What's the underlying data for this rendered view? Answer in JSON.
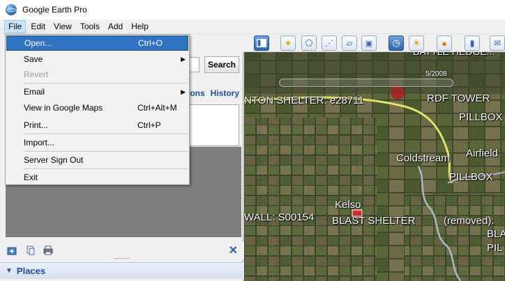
{
  "window": {
    "title": "Google Earth Pro"
  },
  "menubar": {
    "items": [
      "File",
      "Edit",
      "View",
      "Tools",
      "Add",
      "Help"
    ]
  },
  "file_menu": {
    "items": [
      {
        "label": "Open...",
        "shortcut": "Ctrl+O",
        "state": "highlighted"
      },
      {
        "label": "Save",
        "shortcut": "",
        "submenu": true
      },
      {
        "label": "Revert",
        "shortcut": "",
        "state": "disabled"
      },
      {
        "label": "Email",
        "shortcut": "",
        "submenu": true
      },
      {
        "label": "View in Google Maps",
        "shortcut": "Ctrl+Alt+M"
      },
      {
        "label": "Print...",
        "shortcut": "Ctrl+P"
      },
      {
        "label": "Import...",
        "shortcut": ""
      },
      {
        "label": "Server Sign Out",
        "shortcut": ""
      },
      {
        "label": "Exit",
        "shortcut": ""
      }
    ]
  },
  "search": {
    "button_label": "Search",
    "value": ""
  },
  "search_tabs": {
    "directions_partial": "ons",
    "history": "History"
  },
  "places": {
    "header": "Places"
  },
  "map": {
    "time_label": "5/2008",
    "labels": [
      "BATTLE HEDGE...",
      "NTON SHELTER: e28711",
      "RDF TOWER",
      "PILLBOX",
      "Coldstream",
      "Airfield",
      "PILLBOX",
      "Kelso",
      "WALL: S00154",
      "BLAST SHELTER",
      "(removed):",
      "BLA",
      "PIL"
    ]
  },
  "colors": {
    "accent": "#3173c0",
    "link": "#1f4e9c",
    "road": "#e4e06a",
    "river": "#aab8c8"
  }
}
